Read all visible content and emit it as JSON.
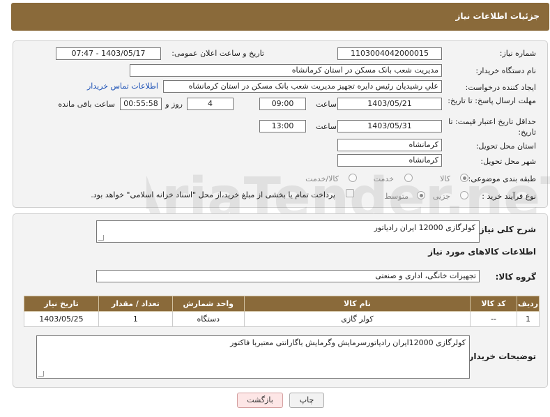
{
  "header": {
    "title": "جزئیات اطلاعات نیاز"
  },
  "need": {
    "number_label": "شماره نیاز:",
    "number_value": "1103004042000015",
    "announce_label": "تاریخ و ساعت اعلان عمومی:",
    "announce_value": "1403/05/17 - 07:47",
    "buyer_label": "نام دستگاه خریدار:",
    "buyer_value": "مدیریت شعب بانک مسکن در استان کرمانشاه",
    "creator_label": "ایجاد کننده درخواست:",
    "creator_value": "علي رشيديان رئيس دايره تجهيز  مدیریت شعب بانک مسکن در استان کرمانشاه",
    "contact_link": "اطلاعات تماس خریدار",
    "deadline_label": "مهلت ارسال پاسخ: تا تاریخ:",
    "deadline_date": "1403/05/21",
    "time_label": "ساعت",
    "deadline_time": "09:00",
    "days_value": "4",
    "days_label": "روز و",
    "remaining_value": "00:55:58",
    "remaining_label": "ساعت باقی مانده",
    "validity_label": "حداقل تاریخ اعتبار قیمت: تا تاریخ:",
    "validity_date": "1403/05/31",
    "validity_time": "13:00",
    "province_label": "استان محل تحویل:",
    "province_value": "کرمانشاه",
    "city_label": "شهر محل تحویل:",
    "city_value": "کرمانشاه",
    "category_label": "طبقه بندی موضوعی:",
    "category_options": [
      "کالا",
      "خدمت",
      "کالا/خدمت"
    ],
    "process_label": "نوع فرآیند خرید :",
    "process_options": [
      "جزیی",
      "متوسط"
    ],
    "payment_note": "پرداخت تمام یا بخشی از مبلغ خرید،از محل \"اسناد خزانه اسلامی\" خواهد بود."
  },
  "details": {
    "desc_label": "شرح کلی نیاز:",
    "desc_value": "کولرگازی 12000 ایران رادیاتور",
    "goods_info_title": "اطلاعات کالاهای مورد نیاز",
    "group_label": "گروه کالا:",
    "group_value": "تجهیزات خانگی، اداری و صنعتی",
    "table_headers": [
      "ردیف",
      "کد کالا",
      "نام کالا",
      "واحد شمارش",
      "تعداد / مقدار",
      "تاریخ نیاز"
    ],
    "table_rows": [
      [
        "1",
        "--",
        "کولر گازی",
        "دستگاه",
        "1",
        "1403/05/25"
      ]
    ],
    "buyer_notes_label": "توضیحات خریدار:",
    "buyer_notes_value": "کولرگازی 12000ایران رادیاتورسرمایش وگرمایش باگارانتی معتبربا فاکتور"
  },
  "buttons": {
    "print": "چاپ",
    "back": "بازگشت"
  },
  "watermark_text": "AriaTender.neT"
}
